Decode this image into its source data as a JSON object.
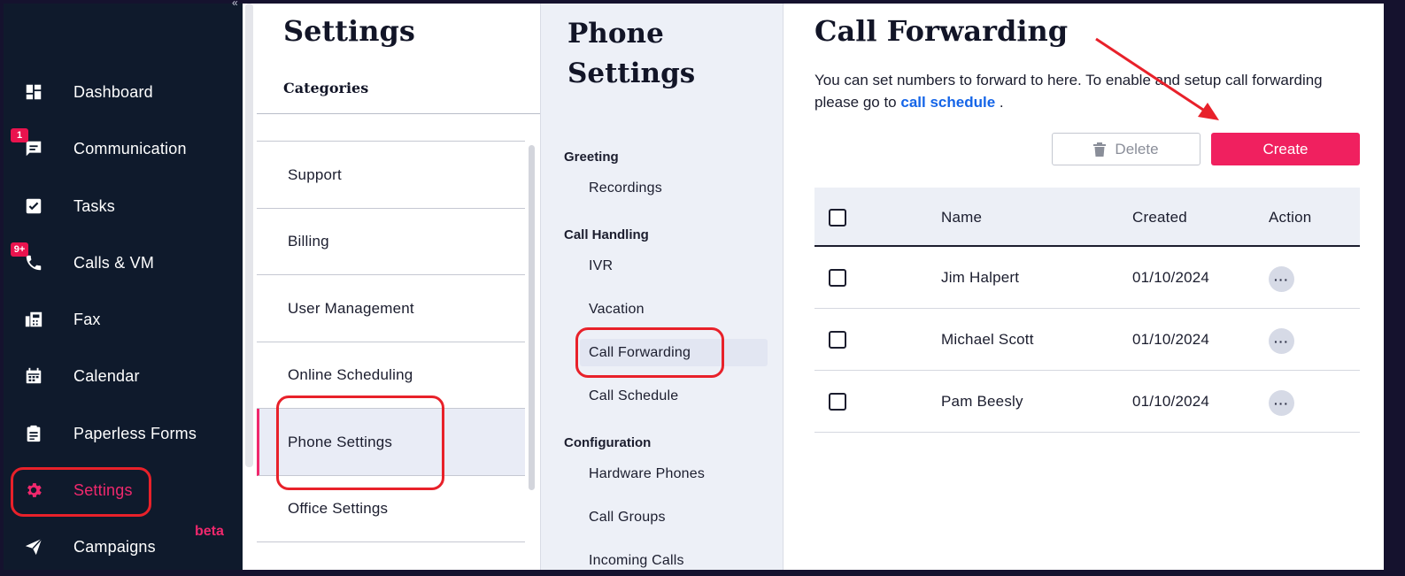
{
  "sidebar": {
    "collapse_glyph": "«",
    "items": [
      {
        "label": "Dashboard",
        "icon": "dashboard-icon",
        "badge": ""
      },
      {
        "label": "Communication",
        "icon": "chat-icon",
        "badge": "1"
      },
      {
        "label": "Tasks",
        "icon": "checkbox-icon",
        "badge": ""
      },
      {
        "label": "Calls & VM",
        "icon": "phone-icon",
        "badge": "9+"
      },
      {
        "label": "Fax",
        "icon": "fax-icon",
        "badge": ""
      },
      {
        "label": "Calendar",
        "icon": "calendar-icon",
        "badge": ""
      },
      {
        "label": "Paperless Forms",
        "icon": "clipboard-icon",
        "badge": ""
      },
      {
        "label": "Settings",
        "icon": "gear-icon",
        "badge": "",
        "active": true
      },
      {
        "label": "Campaigns",
        "icon": "paper-plane-icon",
        "badge": "",
        "tag": "beta"
      }
    ]
  },
  "settings": {
    "title": "Settings",
    "categories_label": "Categories",
    "items": [
      "Support",
      "Billing",
      "User Management",
      "Online Scheduling",
      "Phone Settings",
      "Office Settings"
    ],
    "active": "Phone Settings"
  },
  "phone_settings": {
    "title": "Phone Settings",
    "groups": [
      {
        "label": "Greeting",
        "items": [
          "Recordings"
        ]
      },
      {
        "label": "Call Handling",
        "items": [
          "IVR",
          "Vacation",
          "Call Forwarding",
          "Call Schedule"
        ]
      },
      {
        "label": "Configuration",
        "items": [
          "Hardware Phones",
          "Call Groups",
          "Incoming Calls"
        ]
      }
    ],
    "active": "Call Forwarding"
  },
  "call_forwarding": {
    "title": "Call Forwarding",
    "description": "You can set numbers to forward to here. To enable and setup call forwarding please go to",
    "link_text": "call schedule",
    "description_end": " .",
    "delete_label": "Delete",
    "create_label": "Create",
    "columns": [
      "Name",
      "Created",
      "Action"
    ],
    "rows": [
      {
        "name": "Jim Halpert",
        "created": "01/10/2024"
      },
      {
        "name": "Michael Scott",
        "created": "01/10/2024"
      },
      {
        "name": "Pam Beesly",
        "created": "01/10/2024"
      }
    ],
    "action_glyph": "···"
  },
  "colors": {
    "accent": "#f0286d",
    "sidebar_bg": "#0f1a2c",
    "link": "#1565e8",
    "annotation": "#e8212a"
  }
}
